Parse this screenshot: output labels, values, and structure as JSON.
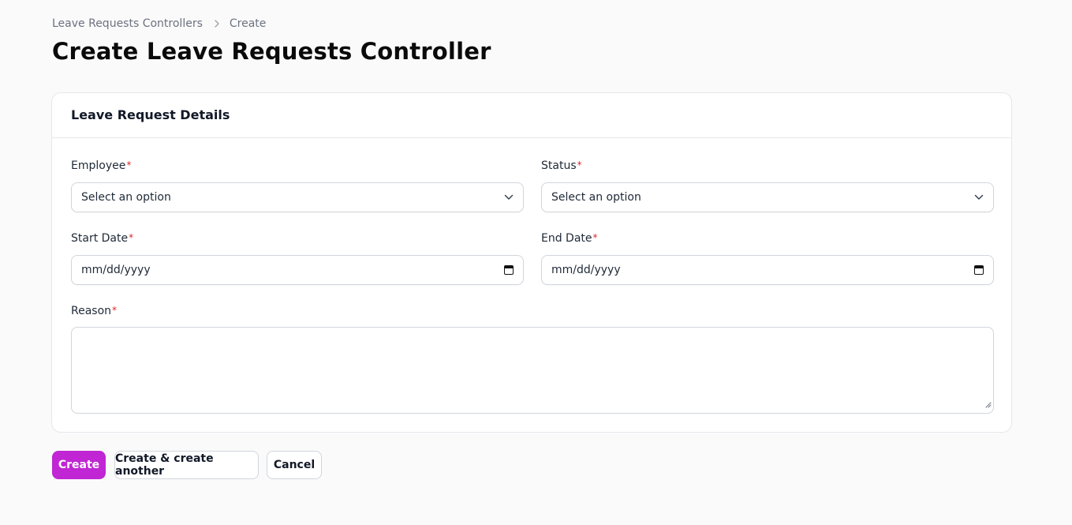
{
  "breadcrumb": {
    "items": [
      "Leave Requests Controllers",
      "Create"
    ]
  },
  "page": {
    "title": "Create Leave Requests Controller"
  },
  "form": {
    "section_title": "Leave Request Details",
    "employee": {
      "label": "Employee",
      "required_mark": "*",
      "value": "Select an option"
    },
    "status": {
      "label": "Status",
      "required_mark": "*",
      "value": "Select an option"
    },
    "start_date": {
      "label": "Start Date",
      "required_mark": "*",
      "placeholder": "mm/dd/yyyy"
    },
    "end_date": {
      "label": "End Date",
      "required_mark": "*",
      "placeholder": "mm/dd/yyyy"
    },
    "reason": {
      "label": "Reason",
      "required_mark": "*",
      "value": ""
    }
  },
  "actions": {
    "create": "Create",
    "create_another": "Create & create another",
    "cancel": "Cancel"
  },
  "colors": {
    "primary": "#c026d3",
    "required": "#dc2626",
    "background": "#fafafa"
  }
}
